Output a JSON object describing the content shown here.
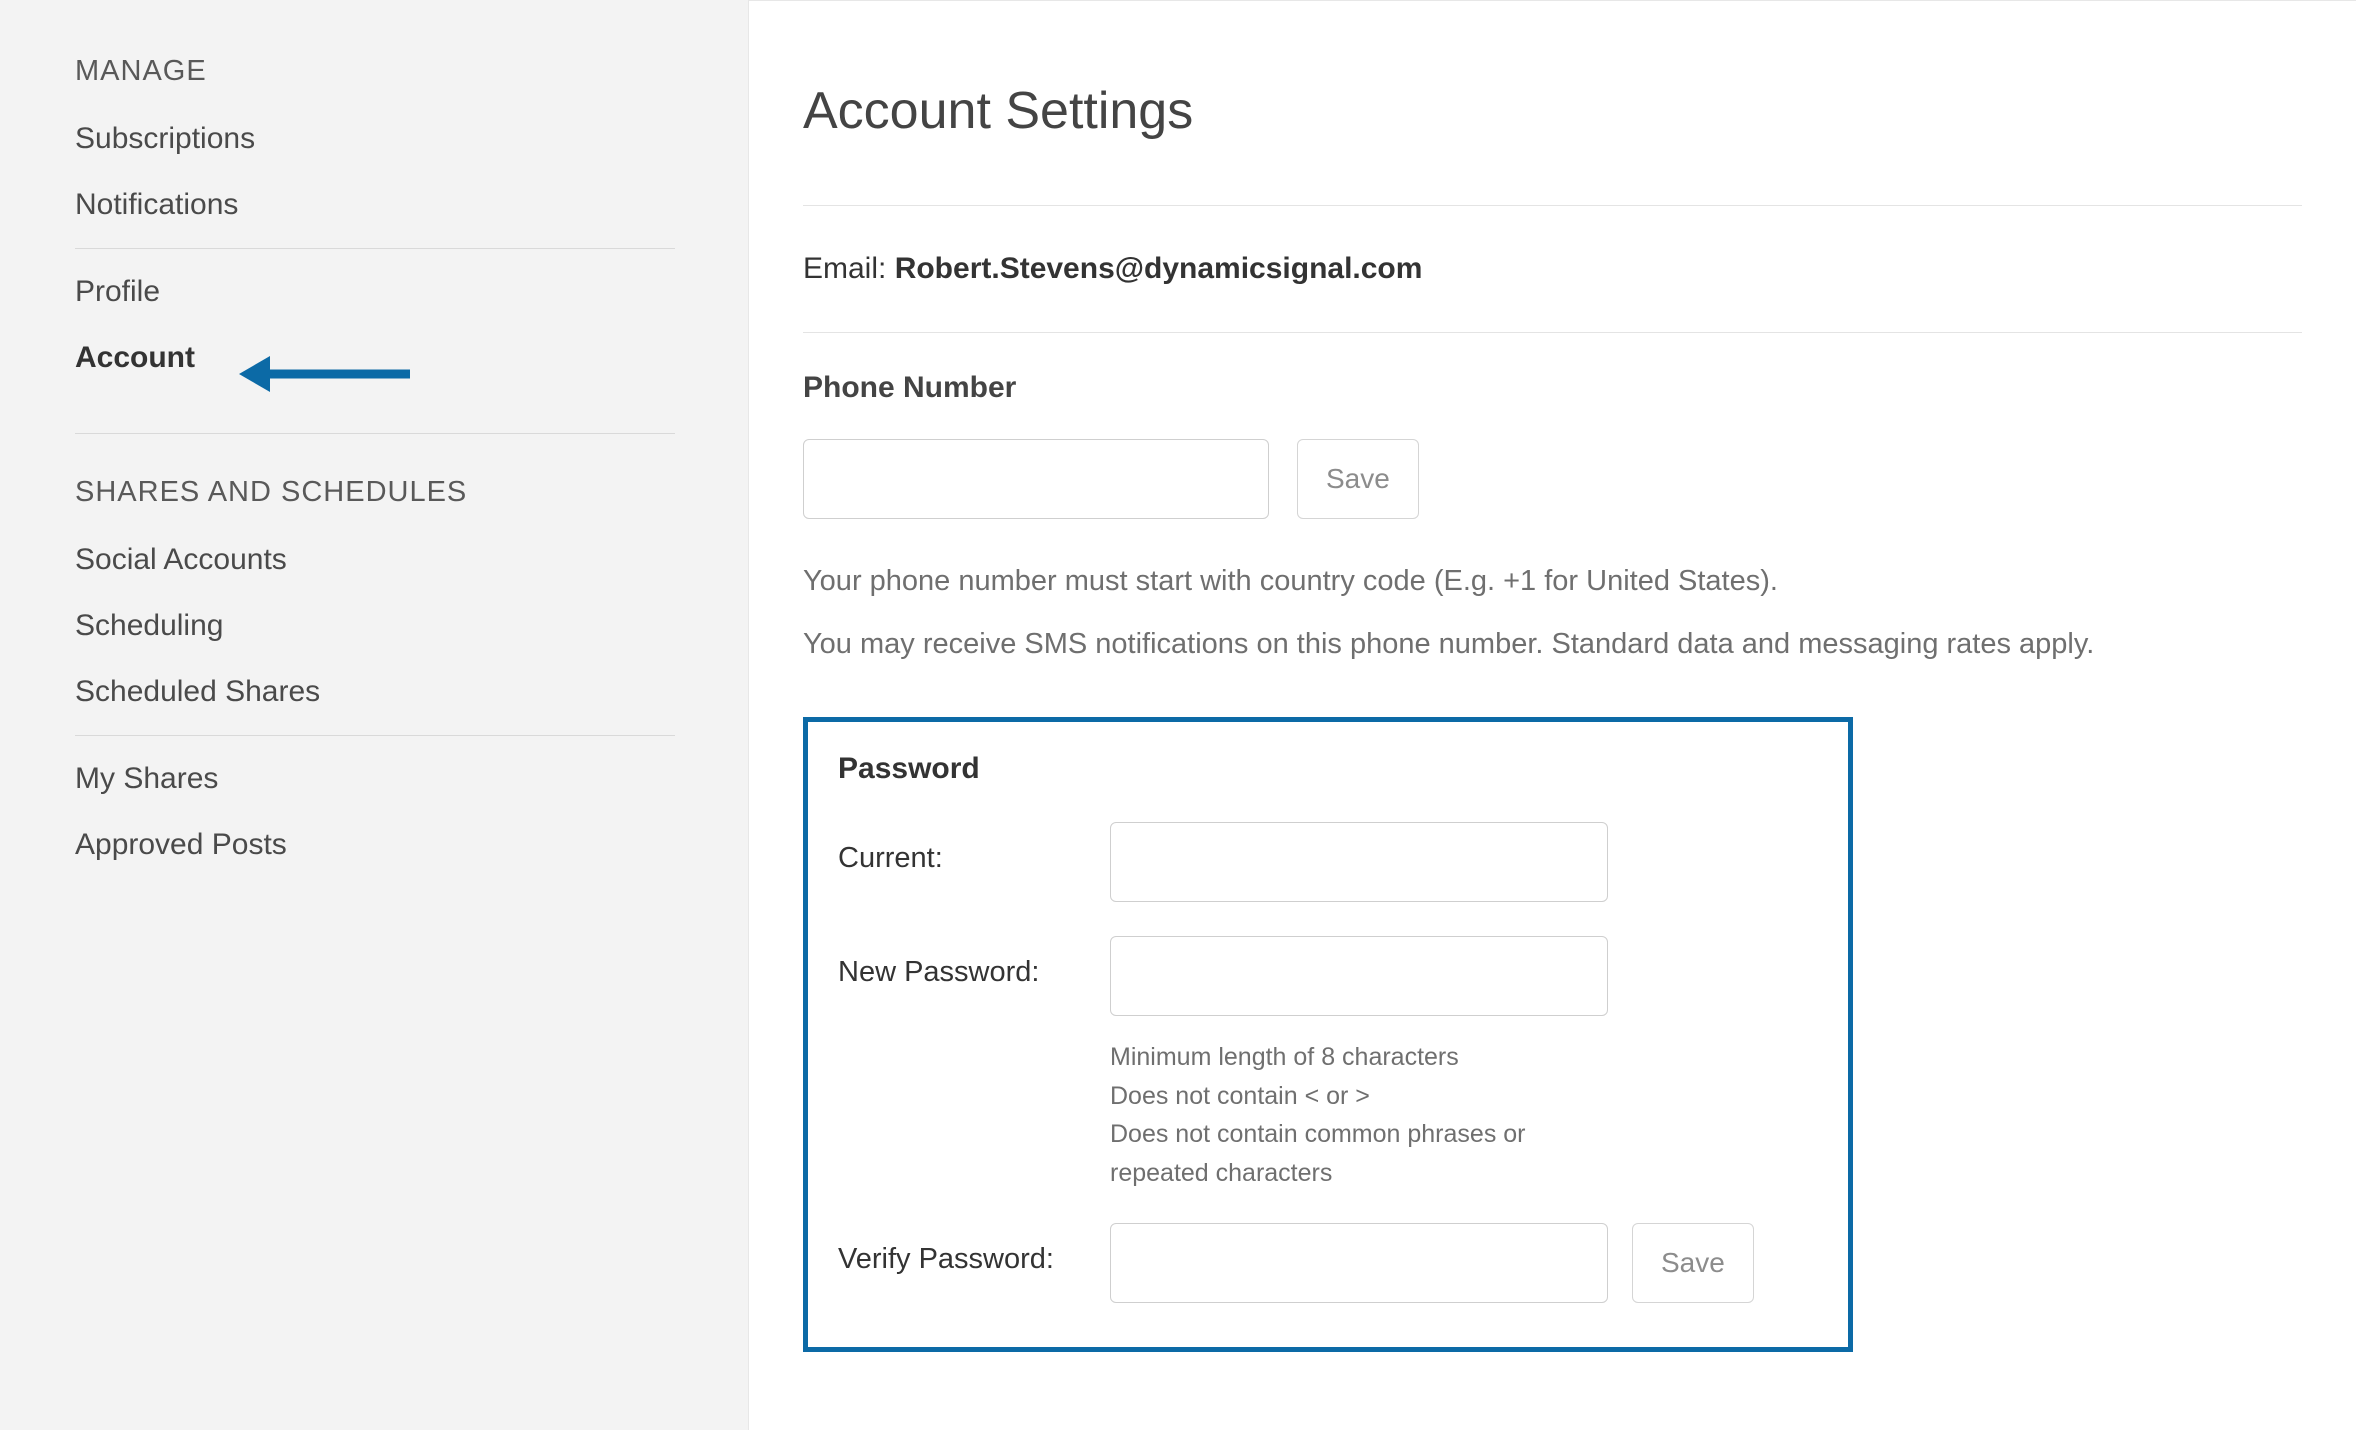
{
  "sidebar": {
    "section1_header": "MANAGE",
    "group1": [
      {
        "label": "Subscriptions"
      },
      {
        "label": "Notifications"
      }
    ],
    "group2": [
      {
        "label": "Profile"
      },
      {
        "label": "Account",
        "active": true
      }
    ],
    "section2_header": "SHARES AND SCHEDULES",
    "group3": [
      {
        "label": "Social Accounts"
      },
      {
        "label": "Scheduling"
      },
      {
        "label": "Scheduled Shares"
      }
    ],
    "group4": [
      {
        "label": "My Shares"
      },
      {
        "label": "Approved Posts"
      }
    ]
  },
  "main": {
    "title": "Account Settings",
    "email_label": "Email: ",
    "email_value": "Robert.Stevens@dynamicsignal.com",
    "phone": {
      "heading": "Phone Number",
      "value": "",
      "save_label": "Save",
      "help1": "Your phone number must start with country code (E.g. +1 for United States).",
      "help2": "You may receive SMS notifications on this phone number. Standard data and messaging rates apply."
    },
    "password": {
      "heading": "Password",
      "current_label": "Current:",
      "current_value": "",
      "new_label": "New Password:",
      "new_value": "",
      "req1": "Minimum length of 8 characters",
      "req2": "Does not contain < or >",
      "req3": "Does not contain common phrases or repeated characters",
      "verify_label": "Verify Password:",
      "verify_value": "",
      "save_label": "Save"
    }
  }
}
